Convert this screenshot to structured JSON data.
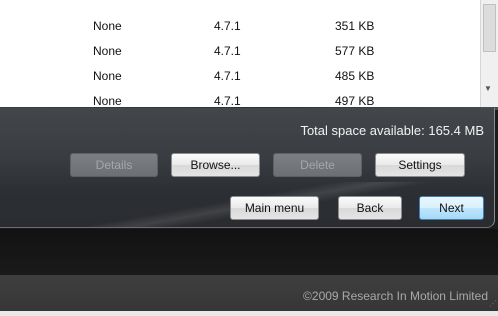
{
  "file_list": {
    "rows": [
      {
        "name": "None",
        "version": "4.7.1",
        "size": "351 KB"
      },
      {
        "name": "None",
        "version": "4.7.1",
        "size": "577 KB"
      },
      {
        "name": "None",
        "version": "4.7.1",
        "size": "485 KB"
      },
      {
        "name": "None",
        "version": "4.7.1",
        "size": "497 KB"
      }
    ]
  },
  "storage": {
    "space_label": "Total space available: 165.4 MB"
  },
  "actions": {
    "details": "Details",
    "browse": "Browse...",
    "delete": "Delete",
    "settings": "Settings"
  },
  "navigation": {
    "main_menu": "Main menu",
    "back": "Back",
    "next": "Next"
  },
  "footer": {
    "copyright": "©2009 Research In Motion Limited"
  },
  "colors": {
    "primary_button_border": "#3c7fb1",
    "panel_background": "#3a3d42"
  }
}
